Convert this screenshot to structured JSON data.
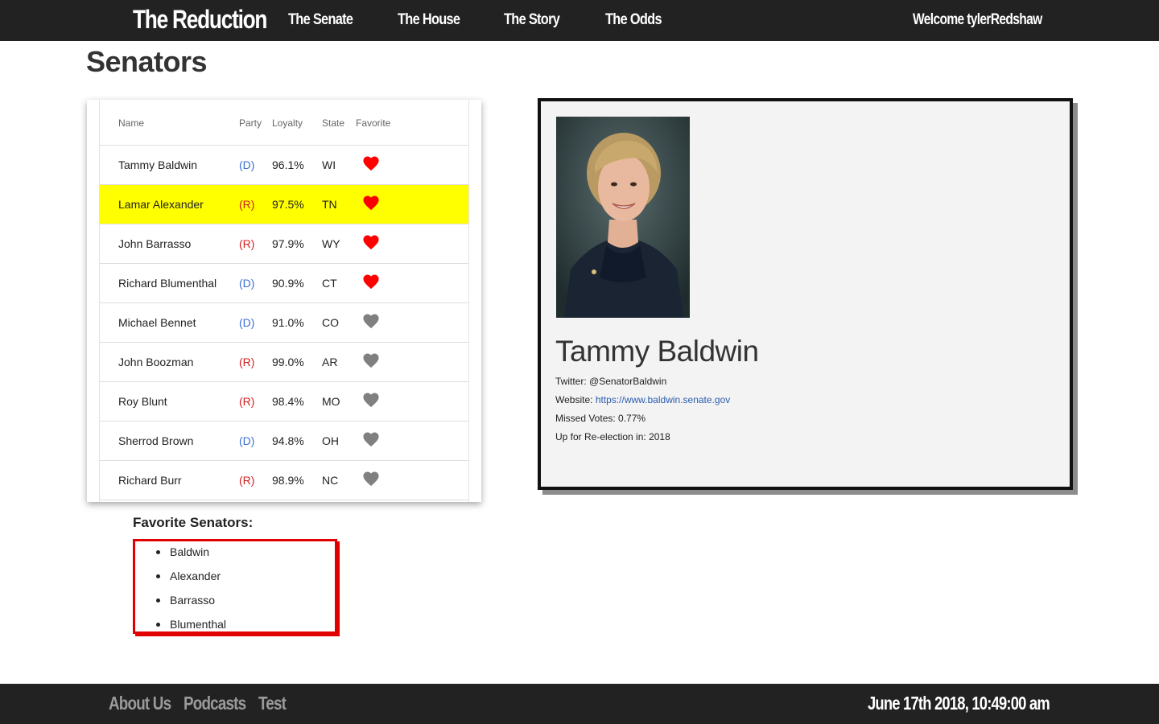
{
  "navbar": {
    "brand": "The Reduction",
    "links": [
      "The Senate",
      "The House",
      "The Story",
      "The Odds"
    ],
    "welcome": "Welcome tylerRedshaw"
  },
  "page_title": "Senators",
  "table": {
    "headers": {
      "name": "Name",
      "party": "Party",
      "loyalty": "Loyalty",
      "state": "State",
      "favorite": "Favorite"
    },
    "rows": [
      {
        "name": "Tammy Baldwin",
        "party": "(D)",
        "loyalty": "96.1%",
        "state": "WI",
        "favorite": true,
        "highlighted": false
      },
      {
        "name": "Lamar Alexander",
        "party": "(R)",
        "loyalty": "97.5%",
        "state": "TN",
        "favorite": true,
        "highlighted": true
      },
      {
        "name": "John Barrasso",
        "party": "(R)",
        "loyalty": "97.9%",
        "state": "WY",
        "favorite": true,
        "highlighted": false
      },
      {
        "name": "Richard Blumenthal",
        "party": "(D)",
        "loyalty": "90.9%",
        "state": "CT",
        "favorite": true,
        "highlighted": false
      },
      {
        "name": "Michael Bennet",
        "party": "(D)",
        "loyalty": "91.0%",
        "state": "CO",
        "favorite": false,
        "highlighted": false
      },
      {
        "name": "John Boozman",
        "party": "(R)",
        "loyalty": "99.0%",
        "state": "AR",
        "favorite": false,
        "highlighted": false
      },
      {
        "name": "Roy Blunt",
        "party": "(R)",
        "loyalty": "98.4%",
        "state": "MO",
        "favorite": false,
        "highlighted": false
      },
      {
        "name": "Sherrod Brown",
        "party": "(D)",
        "loyalty": "94.8%",
        "state": "OH",
        "favorite": false,
        "highlighted": false
      },
      {
        "name": "Richard Burr",
        "party": "(R)",
        "loyalty": "98.9%",
        "state": "NC",
        "favorite": false,
        "highlighted": false
      }
    ]
  },
  "favorites": {
    "title": "Favorite Senators:",
    "items": [
      "Baldwin",
      "Alexander",
      "Barrasso",
      "Blumenthal"
    ]
  },
  "detail": {
    "name": "Tammy Baldwin",
    "twitter_label": "Twitter: ",
    "twitter": "@SenatorBaldwin",
    "website_label": "Website: ",
    "website": "https://www.baldwin.senate.gov",
    "missed_label": "Missed Votes: ",
    "missed": "0.77%",
    "reelection_label": "Up for Re-election in: ",
    "reelection": "2018"
  },
  "footer": {
    "links": [
      "About Us",
      "Podcasts",
      "Test"
    ],
    "clock": "June 17th 2018, 10:49:00 am"
  },
  "colors": {
    "navbar_bg": "#222222",
    "highlight_row": "#ffff00",
    "heart_favorite": "#ff0000",
    "heart_default": "#808080",
    "democrat": "#3b6fd4",
    "republican": "#d42020",
    "favorites_border": "#e00000",
    "link": "#2a5db0"
  }
}
